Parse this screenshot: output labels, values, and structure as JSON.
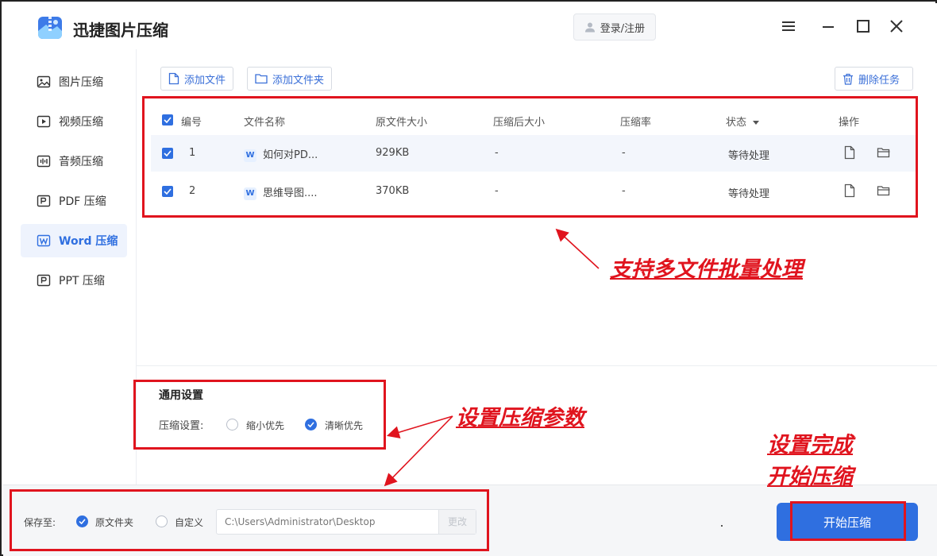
{
  "app": {
    "title": "迅捷图片压缩",
    "login_label": "登录/注册"
  },
  "sidebar": {
    "items": [
      {
        "label": "图片压缩",
        "icon": "image-icon"
      },
      {
        "label": "视频压缩",
        "icon": "video-icon"
      },
      {
        "label": "音频压缩",
        "icon": "audio-icon"
      },
      {
        "label": "PDF 压缩",
        "icon": "pdf-icon"
      },
      {
        "label": "Word 压缩",
        "icon": "word-icon",
        "active": true
      },
      {
        "label": "PPT 压缩",
        "icon": "ppt-icon"
      }
    ]
  },
  "toolbar": {
    "add_file": "添加文件",
    "add_folder": "添加文件夹",
    "delete_task": "删除任务"
  },
  "table": {
    "headers": {
      "index": "编号",
      "name": "文件名称",
      "orig_size": "原文件大小",
      "comp_size": "压缩后大小",
      "ratio": "压缩率",
      "status": "状态",
      "ops": "操作"
    },
    "rows": [
      {
        "index": "1",
        "name": "如何对PD...",
        "orig_size": "929KB",
        "comp_size": "-",
        "ratio": "-",
        "status": "等待处理"
      },
      {
        "index": "2",
        "name": "思维导图....",
        "orig_size": "370KB",
        "comp_size": "-",
        "ratio": "-",
        "status": "等待处理"
      }
    ]
  },
  "settings": {
    "title": "通用设置",
    "compress_label": "压缩设置:",
    "option_small": "缩小优先",
    "option_clear": "清晰优先",
    "selected": "清晰优先"
  },
  "footer": {
    "save_label": "保存至:",
    "option_original": "原文件夹",
    "option_custom": "自定义",
    "path": "C:\\Users\\Administrator\\Desktop",
    "change_label": "更改",
    "start_label": "开始压缩"
  },
  "annotations": {
    "batch": "支持多文件批量处理",
    "params": "设置压缩参数",
    "done_line1": "设置完成",
    "done_line2": "开始压缩"
  },
  "colors": {
    "accent": "#2f6fe0",
    "annotation": "#e0141e"
  }
}
